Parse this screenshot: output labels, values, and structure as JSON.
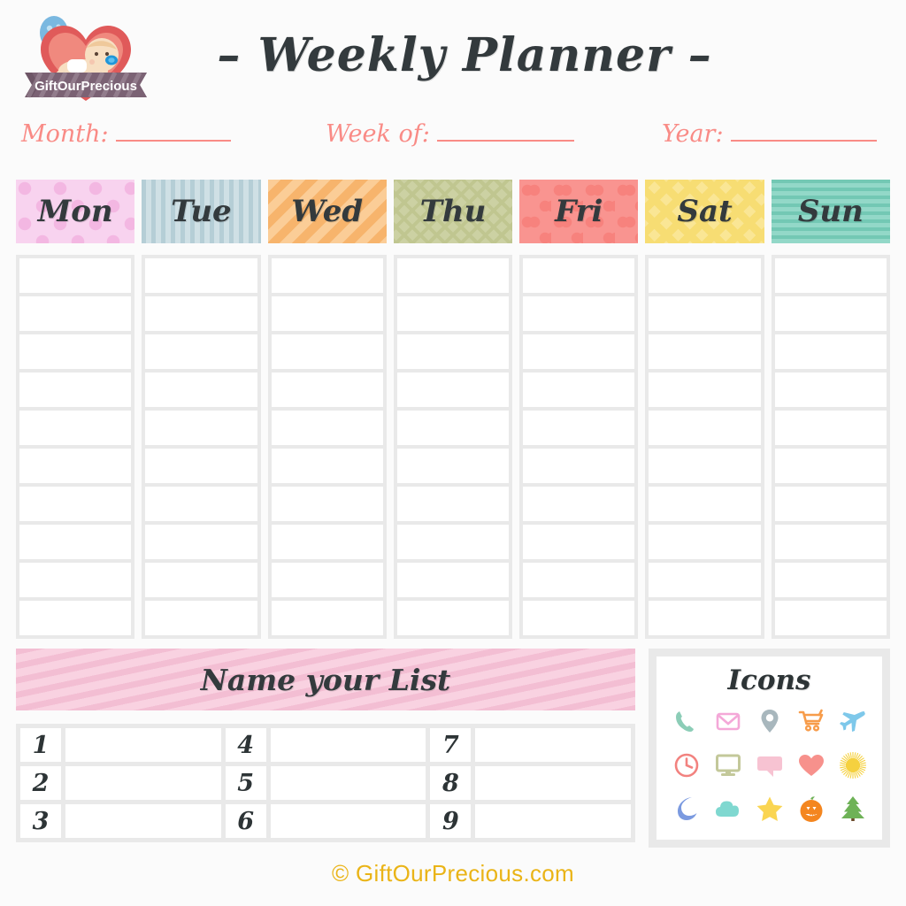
{
  "brand": {
    "logo_name": "GiftOurPrecious",
    "logo_banner_text": "GiftOurPrecious"
  },
  "header": {
    "title": "– Weekly Planner –"
  },
  "fields": [
    {
      "label": "Month:",
      "value": ""
    },
    {
      "label": "Week of:",
      "value": ""
    },
    {
      "label": "Year:",
      "value": ""
    }
  ],
  "week": {
    "days": [
      {
        "label": "Mon",
        "pattern": "polka-dots",
        "color": "#f8d3ef"
      },
      {
        "label": "Tue",
        "pattern": "vertical-stripes",
        "color": "#c4d9df"
      },
      {
        "label": "Wed",
        "pattern": "diagonal-stripes",
        "color": "#f9bf7f"
      },
      {
        "label": "Thu",
        "pattern": "lattice",
        "color": "#ccd1a3"
      },
      {
        "label": "Fri",
        "pattern": "hearts",
        "color": "#f99490"
      },
      {
        "label": "Sat",
        "pattern": "chevron",
        "color": "#fae695"
      },
      {
        "label": "Sun",
        "pattern": "horizontal-stripes",
        "color": "#7fcfbd"
      }
    ],
    "rows_per_day": 10,
    "cell_values": [
      [
        "",
        "",
        "",
        "",
        "",
        "",
        "",
        "",
        "",
        ""
      ],
      [
        "",
        "",
        "",
        "",
        "",
        "",
        "",
        "",
        "",
        ""
      ],
      [
        "",
        "",
        "",
        "",
        "",
        "",
        "",
        "",
        "",
        ""
      ],
      [
        "",
        "",
        "",
        "",
        "",
        "",
        "",
        "",
        "",
        ""
      ],
      [
        "",
        "",
        "",
        "",
        "",
        "",
        "",
        "",
        "",
        ""
      ],
      [
        "",
        "",
        "",
        "",
        "",
        "",
        "",
        "",
        "",
        ""
      ],
      [
        "",
        "",
        "",
        "",
        "",
        "",
        "",
        "",
        "",
        ""
      ]
    ]
  },
  "list": {
    "banner_title": "Name your List",
    "columns": [
      [
        {
          "number": "1",
          "value": ""
        },
        {
          "number": "2",
          "value": ""
        },
        {
          "number": "3",
          "value": ""
        }
      ],
      [
        {
          "number": "4",
          "value": ""
        },
        {
          "number": "5",
          "value": ""
        },
        {
          "number": "6",
          "value": ""
        }
      ],
      [
        {
          "number": "7",
          "value": ""
        },
        {
          "number": "8",
          "value": ""
        },
        {
          "number": "9",
          "value": ""
        }
      ]
    ]
  },
  "icons_panel": {
    "title": "Icons",
    "icons": [
      {
        "name": "phone-icon",
        "color": "#8ccdb7"
      },
      {
        "name": "envelope-icon",
        "color": "#f4a8d8"
      },
      {
        "name": "location-pin-icon",
        "color": "#a8b7bd"
      },
      {
        "name": "shopping-cart-icon",
        "color": "#f79c4a"
      },
      {
        "name": "airplane-icon",
        "color": "#7ec8ea"
      },
      {
        "name": "clock-icon",
        "color": "#f2827f"
      },
      {
        "name": "monitor-icon",
        "color": "#c3c89a"
      },
      {
        "name": "speech-bubble-icon",
        "color": "#f7c3d2"
      },
      {
        "name": "heart-icon",
        "color": "#f7918c"
      },
      {
        "name": "sun-icon",
        "color": "#f5d13f"
      },
      {
        "name": "moon-icon",
        "color": "#7b9ae0"
      },
      {
        "name": "cloud-icon",
        "color": "#7fd8d0"
      },
      {
        "name": "star-icon",
        "color": "#fad552"
      },
      {
        "name": "pumpkin-icon",
        "color": "#f4861f"
      },
      {
        "name": "tree-icon",
        "color": "#6eb257"
      }
    ]
  },
  "footer": {
    "copyright": "© GiftOurPrecious.com"
  },
  "colors": {
    "page_background": "#fbfbfb",
    "accent_pink": "#f98b86",
    "text_dark": "#333a3d",
    "grid_gap": "#e9e9e9",
    "footer_gold": "#eab417"
  }
}
